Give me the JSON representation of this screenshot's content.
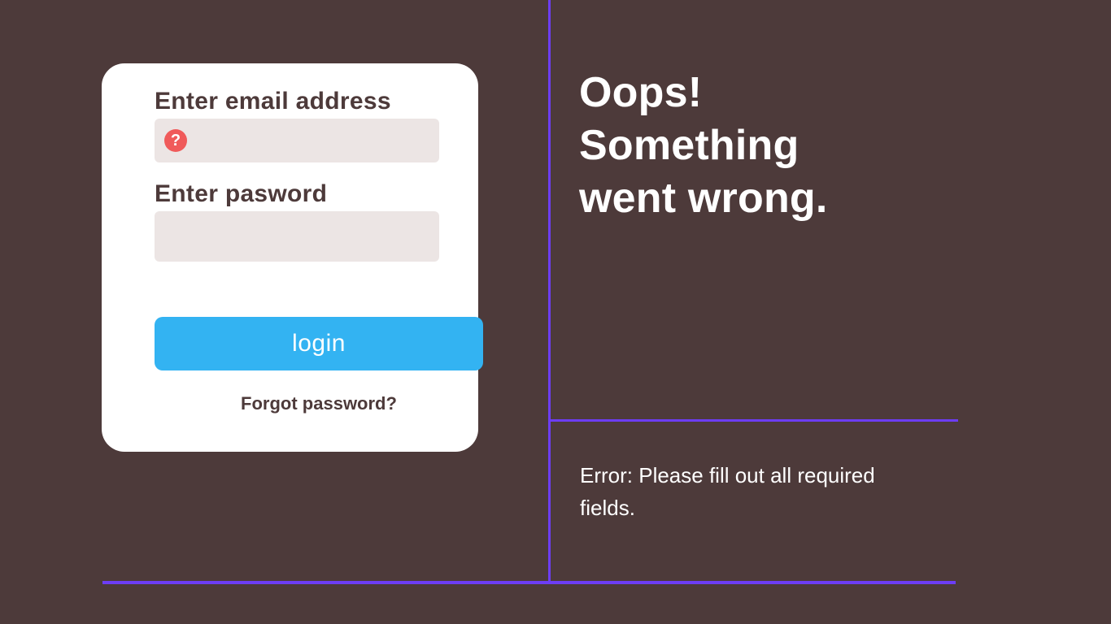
{
  "form": {
    "email_label": "Enter email address",
    "email_value": "",
    "password_label": "Enter pasword",
    "password_value": "",
    "login_button": "login",
    "forgot_link": "Forgot password?",
    "help_icon": "?"
  },
  "error": {
    "heading_line1": "Oops!",
    "heading_line2": "Something",
    "heading_line3": "went wrong.",
    "message": "Error: Please fill out all required fields."
  },
  "colors": {
    "bg": "#4d3a3a",
    "card": "#ffffff",
    "input": "#ece5e4",
    "button": "#33b3f2",
    "accent": "#6d3df5",
    "error_icon": "#f05a5a"
  }
}
